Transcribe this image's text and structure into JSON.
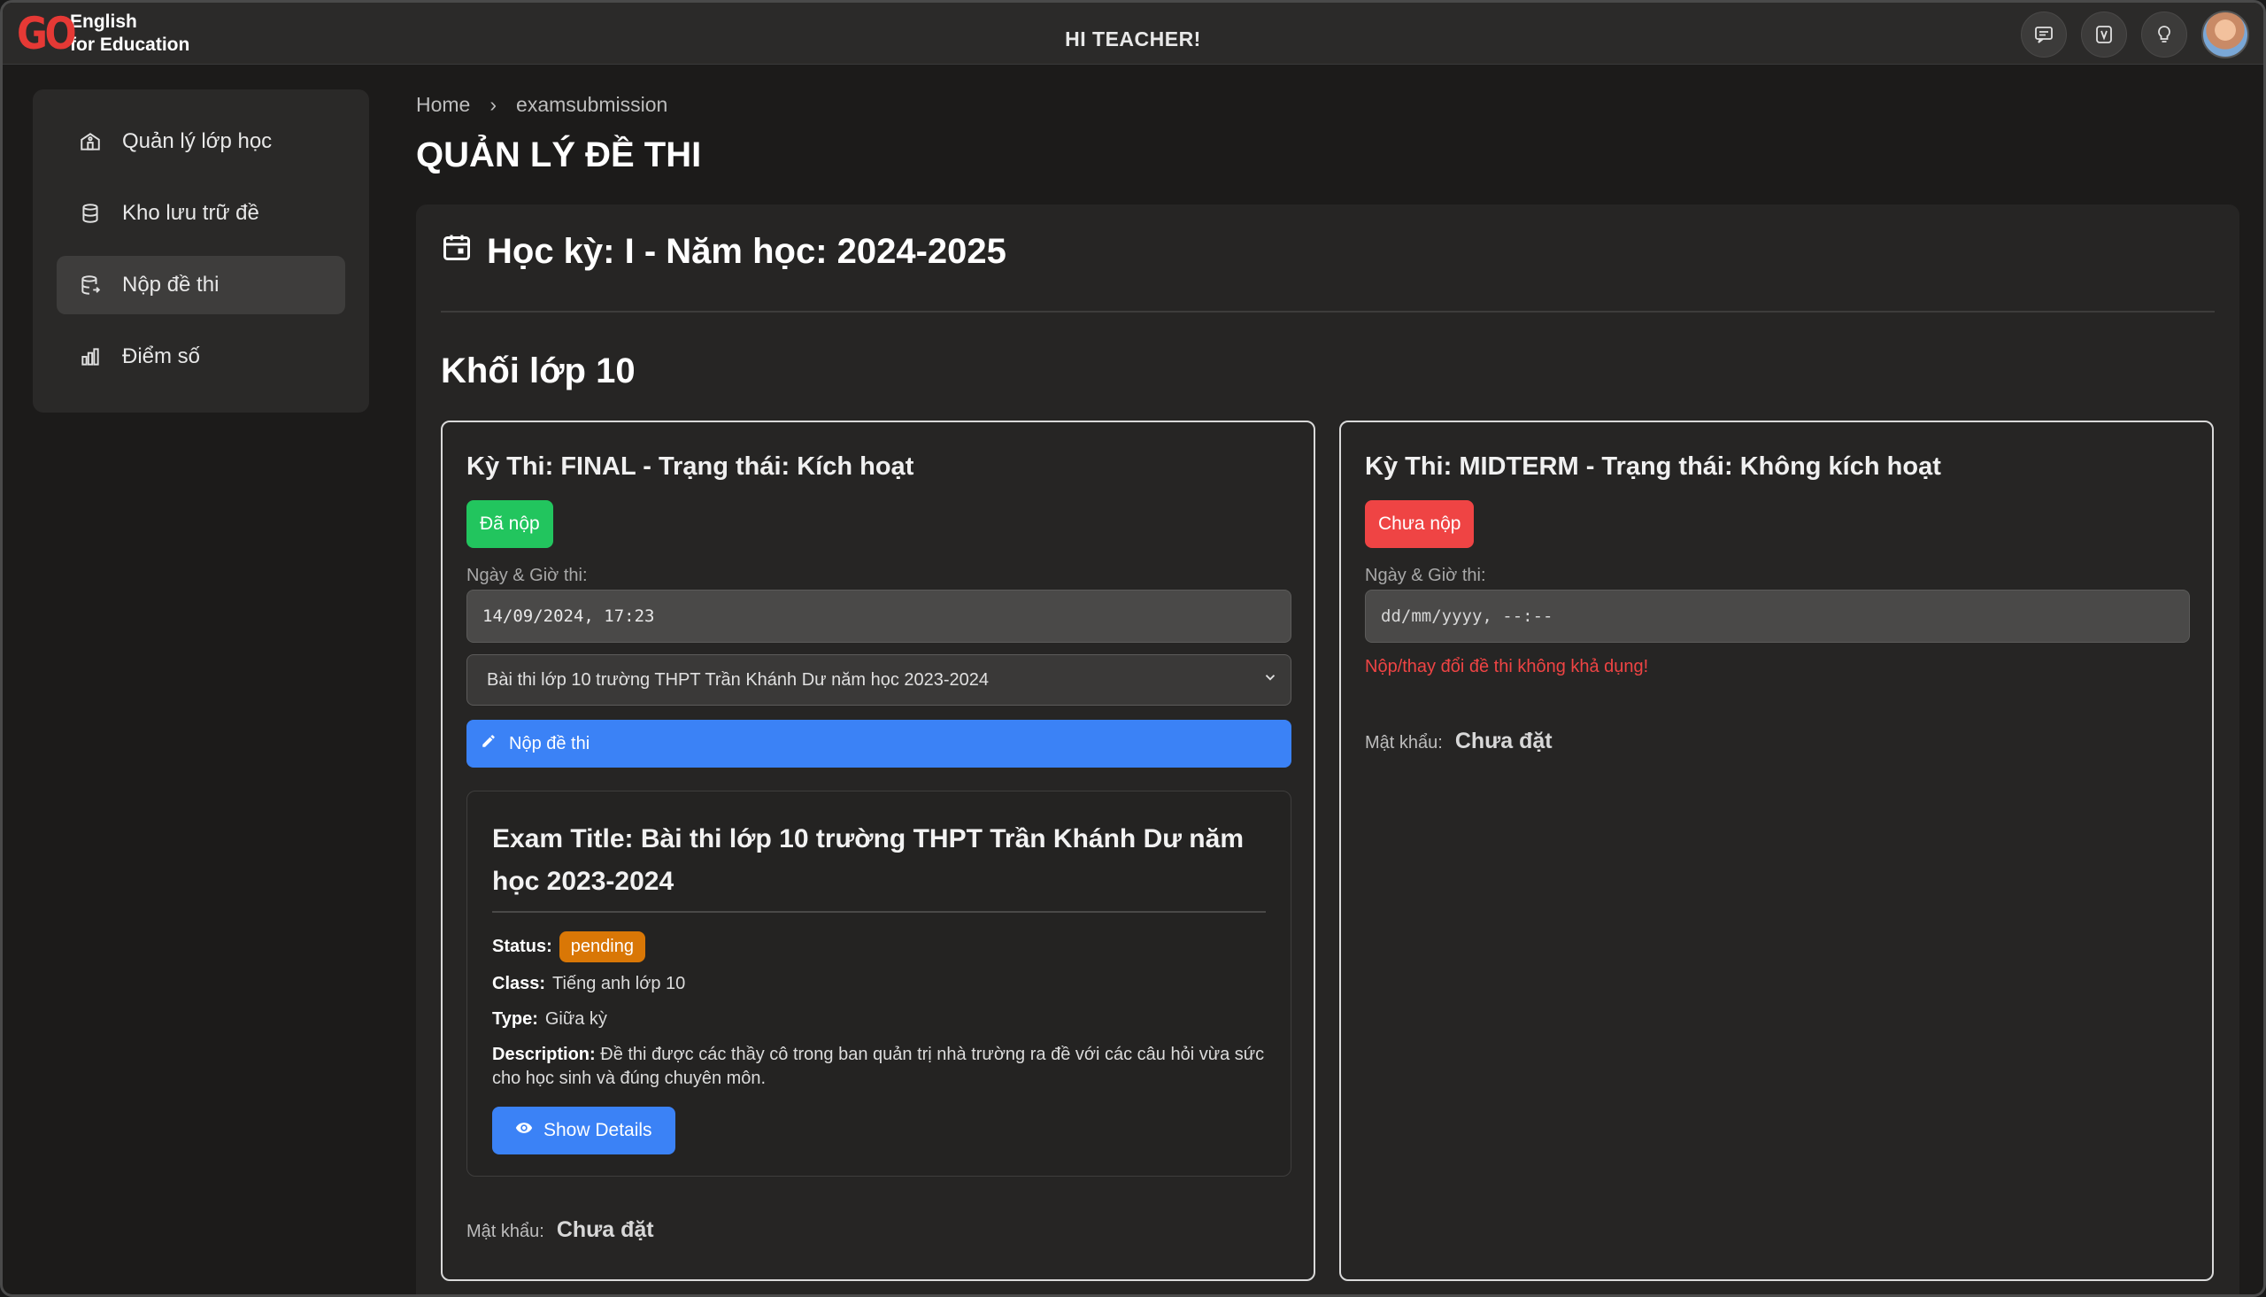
{
  "brand": {
    "logo_mark": "GO",
    "line1": "English",
    "line2": "for Education"
  },
  "header": {
    "greeting": "HI TEACHER!"
  },
  "top_icons": [
    "chat-icon",
    "vocab-icon",
    "lightbulb-icon",
    "user-avatar"
  ],
  "sidebar": {
    "items": [
      {
        "label": "Quản lý lớp học",
        "icon": "school-icon",
        "active": false
      },
      {
        "label": "Kho lưu trữ đề",
        "icon": "database-icon",
        "active": false
      },
      {
        "label": "Nộp đề thi",
        "icon": "submit-database-icon",
        "active": true
      },
      {
        "label": "Điểm số",
        "icon": "chart-icon",
        "active": false
      }
    ]
  },
  "breadcrumb": {
    "home": "Home",
    "separator": "›",
    "current": "examsubmission"
  },
  "page": {
    "title": "QUẢN LÝ ĐỀ THI"
  },
  "semester": {
    "label": "Học kỳ: I - Năm học: 2024-2025"
  },
  "grade": {
    "label": "Khối lớp 10"
  },
  "exams": [
    {
      "title": "Kỳ Thi: FINAL - Trạng thái: Kích hoạt",
      "badge": "Đã nộp",
      "badge_color": "#22c55e",
      "datetime_label": "Ngày & Giờ thi:",
      "datetime_value": "14/09/2024, 17:23",
      "selected_exam": "Bài thi lớp 10 trường THPT Trần Khánh Dư năm học 2023-2024",
      "submit_label": "Nộp đề thi",
      "detail": {
        "title": "Exam Title: Bài thi lớp 10 trường THPT Trần Khánh Dư năm học 2023-2024",
        "status_label": "Status:",
        "status_value": "pending",
        "class_label": "Class:",
        "class_value": "Tiếng anh lớp 10",
        "type_label": "Type:",
        "type_value": "Giữa kỳ",
        "description_label": "Description:",
        "description_value": "Đề thi được các thầy cô trong ban quản trị nhà trường ra đề với các câu hỏi vừa sức cho học sinh và đúng chuyên môn.",
        "show_details_label": "Show Details"
      },
      "password_label": "Mật khẩu:",
      "password_value": "Chưa đặt"
    },
    {
      "title": "Kỳ Thi: MIDTERM - Trạng thái: Không kích hoạt",
      "badge": "Chưa nộp",
      "badge_color": "#ef4444",
      "datetime_label": "Ngày & Giờ thi:",
      "datetime_value": "dd/mm/yyyy, --:--",
      "warning": "Nộp/thay đổi đề thi không khả dụng!",
      "password_label": "Mật khẩu:",
      "password_value": "Chưa đặt"
    }
  ]
}
